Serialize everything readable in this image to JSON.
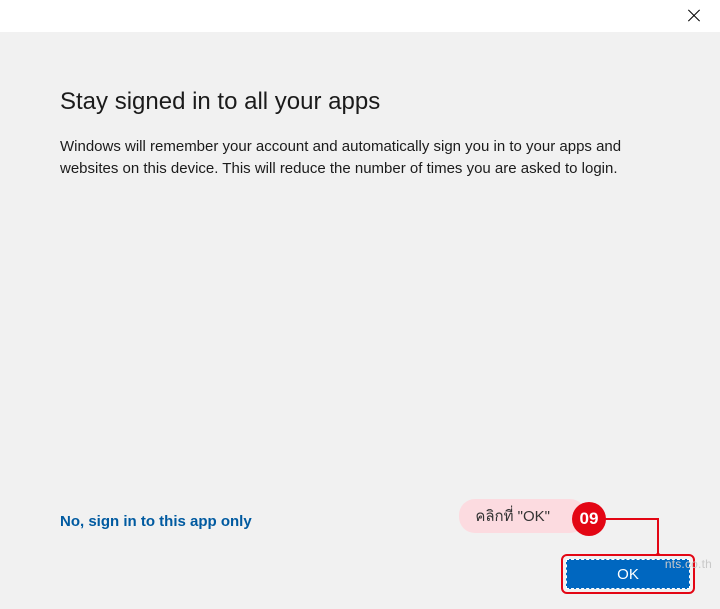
{
  "dialog": {
    "title": "Stay signed in to all your apps",
    "description": "Windows will remember your account and automatically sign you in to your apps and websites on this device. This will reduce the number of times you are asked to login.",
    "link_only_this_app": "No, sign in to this app only",
    "ok_label": "OK"
  },
  "annotation": {
    "callout_text": "คลิกที่ \"OK\"",
    "step_number": "09"
  },
  "watermark": "nts.co.th"
}
